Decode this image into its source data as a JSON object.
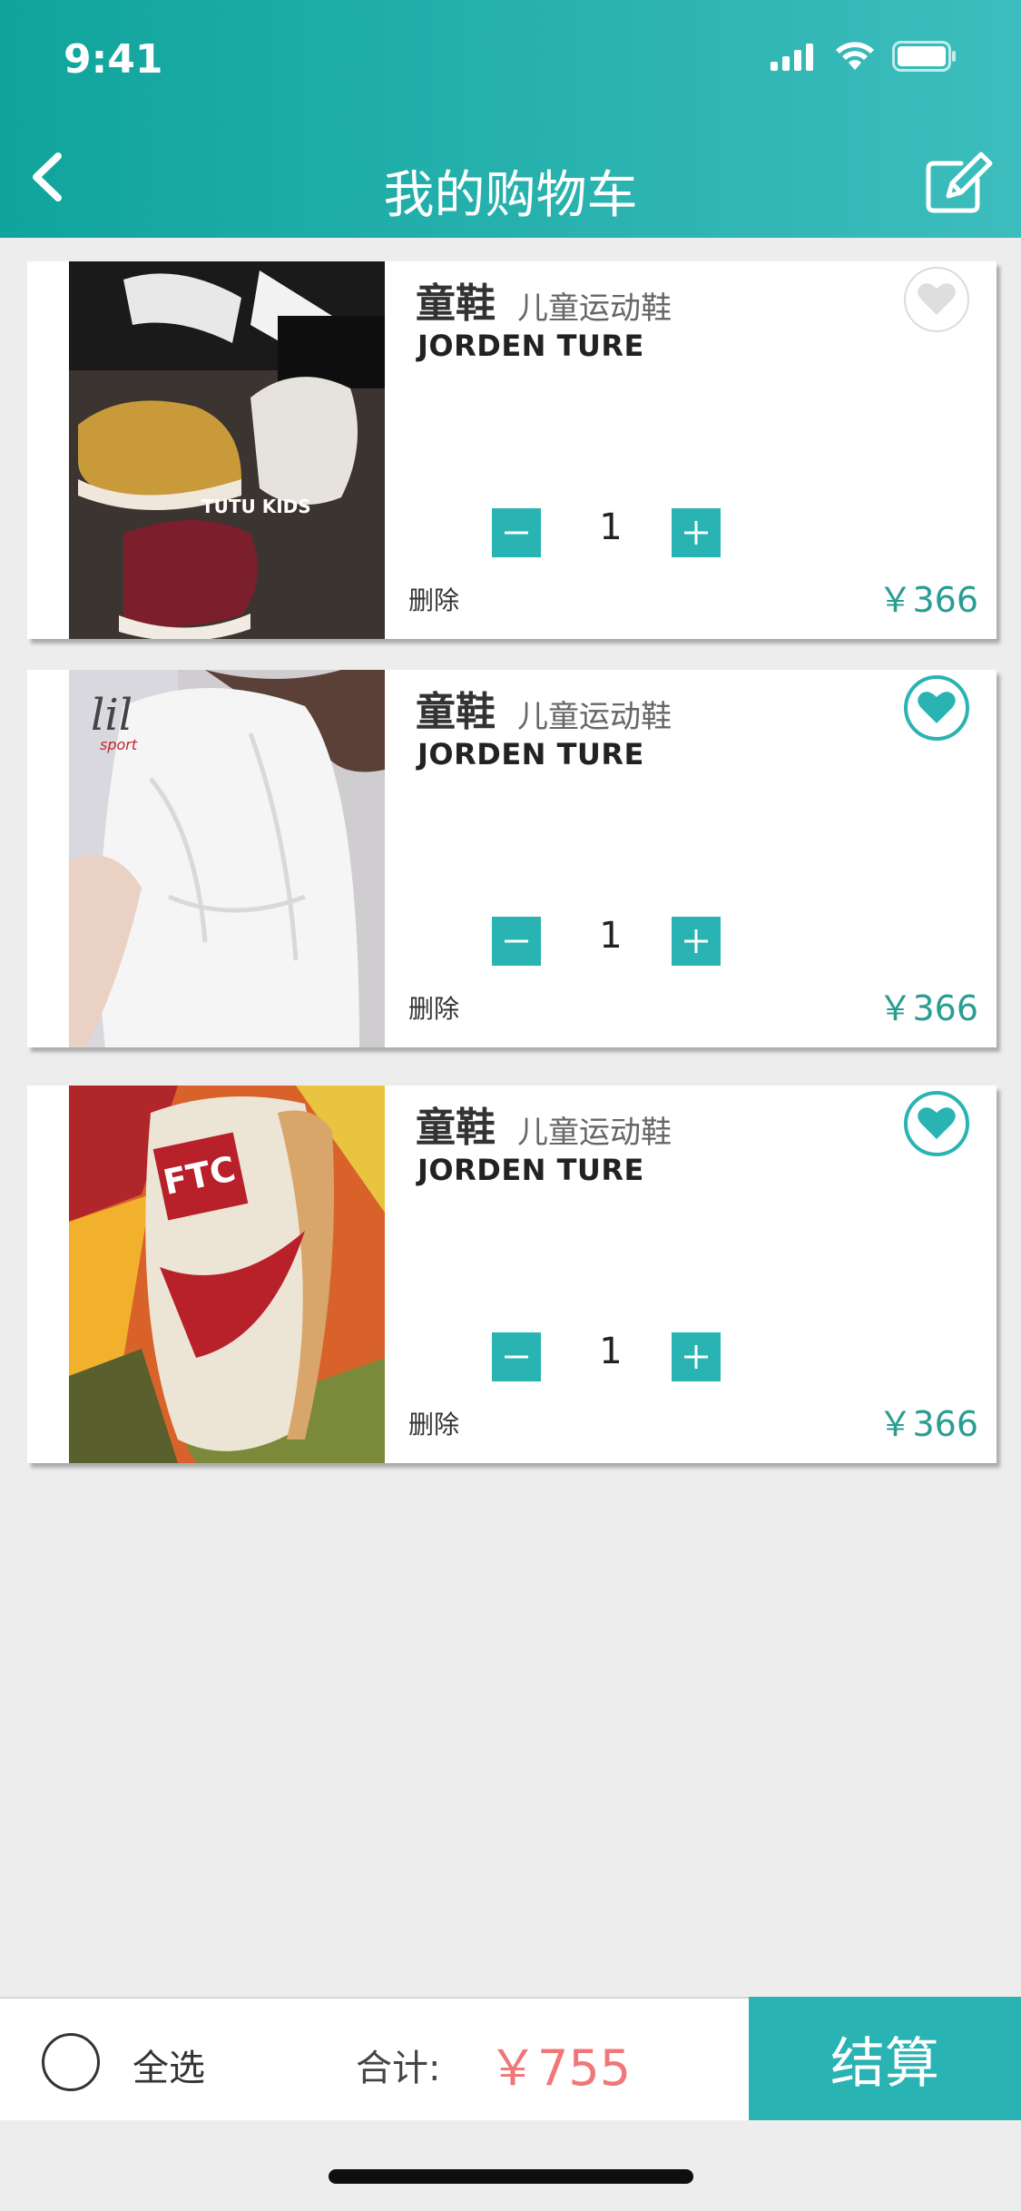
{
  "status_bar": {
    "time": "9:41"
  },
  "header": {
    "title": "我的购物车"
  },
  "cart": {
    "items": [
      {
        "title": "童鞋",
        "subtitle": "儿童运动鞋",
        "model": "JORDEN TURE",
        "qty": "1",
        "delete_label": "删除",
        "price": "￥366",
        "favorited": false,
        "image_caption": "TUTU KIDS"
      },
      {
        "title": "童鞋",
        "subtitle": "儿童运动鞋",
        "model": "JORDEN TURE",
        "qty": "1",
        "delete_label": "删除",
        "price": "￥366",
        "favorited": true
      },
      {
        "title": "童鞋",
        "subtitle": "儿童运动鞋",
        "model": "JORDEN TURE",
        "qty": "1",
        "delete_label": "删除",
        "price": "￥366",
        "favorited": true
      }
    ]
  },
  "footer": {
    "select_all": "全选",
    "total_label": "合计:",
    "total_value": "￥755",
    "checkout": "结算"
  },
  "colors": {
    "accent": "#2ab3b3",
    "price": "#2a9d92",
    "total": "#f07777"
  }
}
